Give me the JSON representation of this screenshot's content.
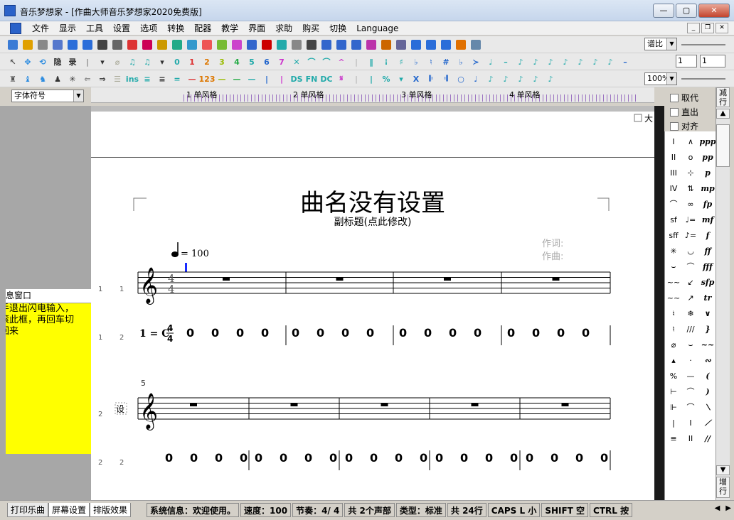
{
  "window": {
    "title": "音乐梦想家 - [作曲大师音乐梦想家2020免费版]",
    "buttons": [
      "—",
      "▢",
      "✕"
    ]
  },
  "menu": [
    "文件",
    "显示",
    "工具",
    "设置",
    "选项",
    "转换",
    "配器",
    "教学",
    "界面",
    "求助",
    "购买",
    "切换",
    "Language"
  ],
  "toolbar": {
    "view_select": "谱比",
    "zoom_select": "100%",
    "spin1": "1",
    "spin2": "1",
    "toolbar1_icons": [
      "save-icon",
      "open-icon",
      "folder-icon",
      "piano-icon",
      "play-icon",
      "step-icon",
      "pause-icon",
      "rewind-icon",
      "cut-icon",
      "copy-icon",
      "paste-icon",
      "undo-icon",
      "redo-icon",
      "note-icon",
      "lyrics-icon",
      "mark-icon",
      "tie-icon",
      "dot-icon",
      "bracket-icon",
      "slur-icon",
      "line-icon",
      "plus-icon",
      "text-icon",
      "left-icon",
      "chord-icon",
      "link-icon",
      "beam-icon",
      "note2-icon",
      "note3-icon",
      "note4-icon",
      "up-icon",
      "down-icon"
    ],
    "toolbar2_labels": [
      "↖",
      "✥",
      "⟲",
      "隐",
      "录",
      "|",
      "▾",
      "⌀",
      "♫",
      "♫",
      "▾",
      "0",
      "1",
      "2",
      "3",
      "4",
      "5",
      "6",
      "7",
      "✕",
      "⌒",
      "⌒",
      "^",
      "|",
      "‖",
      "⁝",
      "♯",
      "♭",
      "♮",
      "#",
      "♭",
      "≻",
      "♩",
      "–",
      "♪",
      "♪",
      "♪",
      "♪",
      "♪",
      "♪",
      "♪",
      "–"
    ],
    "toolbar3_labels": [
      "♜",
      "♝",
      "♞",
      "♟",
      "✳",
      "⇐",
      "⇒",
      "☰",
      "ins",
      "≡",
      "≡",
      "=",
      "—",
      "123",
      "—",
      "—",
      "—",
      "|",
      "|",
      "DS",
      "FN",
      "DC",
      "𝄋",
      "|",
      "|",
      "%",
      "▾",
      "X",
      "𝄆",
      "𝄇",
      "○",
      "♩",
      "♪",
      "♪",
      "♪",
      "♪",
      "♪"
    ]
  },
  "font_select": "字体符号",
  "ruler": {
    "labels": [
      "1 单风格",
      "2 单风格",
      "3 单风格",
      "4 单风格"
    ]
  },
  "info_panel": {
    "title": "息窗口",
    "lines": [
      "手退出闪电输入，",
      "滚此框，再回车切",
      "回来"
    ]
  },
  "score": {
    "title": "曲名没有设置",
    "subtitle": "副标题(点此修改)",
    "lyricist": "作词:",
    "composer": "作曲:",
    "tempo": "= 100",
    "time_sig_top": "4",
    "time_sig_bottom": "4",
    "key_label": "1 = C",
    "jianpu_measure": [
      "0",
      "0",
      "0",
      "0"
    ],
    "row_labels": [
      [
        "1",
        "1"
      ],
      [
        "1",
        "2"
      ],
      [
        "2",
        ""
      ],
      [
        "2",
        "2"
      ]
    ],
    "measure_number": "5",
    "instrument_tag": "设",
    "large_checkbox": "大"
  },
  "palette_ctrl": {
    "options": [
      "取代",
      "直出",
      "对齐"
    ],
    "scroll_top": "减行",
    "scroll_bottom": "增行"
  },
  "palette": {
    "col1": [
      "I",
      "II",
      "III",
      "IV",
      "⌒",
      "sf",
      "sff",
      "✳",
      "⌣",
      "~~",
      "~~",
      "♮",
      "♮",
      "⌀",
      "▴",
      "%",
      "⊢",
      "⊩",
      "|",
      "≡"
    ],
    "col2": [
      "∧",
      "o",
      "⊹",
      "⇅",
      "∞",
      "♩=",
      "♪=",
      "◡",
      "⌒",
      "↙",
      "↗",
      "❄",
      "///",
      "⌣",
      "·",
      "—",
      "⌒",
      "⌒",
      "I",
      "II"
    ],
    "col3": [
      "ppp",
      "pp",
      "p",
      "mp",
      "fp",
      "mf",
      "f",
      "ff",
      "fff",
      "sfp",
      "tr",
      "∨",
      "}",
      "~~",
      "∾",
      "(",
      ")",
      "⟍",
      "⟋",
      "//"
    ]
  },
  "statusbar": {
    "tabs": [
      "打印乐曲",
      "屏幕设置",
      "排版效果"
    ],
    "cells": [
      "系统信息：欢迎使用。",
      "速度：100",
      "节奏：4/ 4",
      "共 2个声部",
      "类型：标准",
      "共 24行",
      "CAPS L 小",
      "SHIFT 空",
      "CTRL 按"
    ]
  }
}
